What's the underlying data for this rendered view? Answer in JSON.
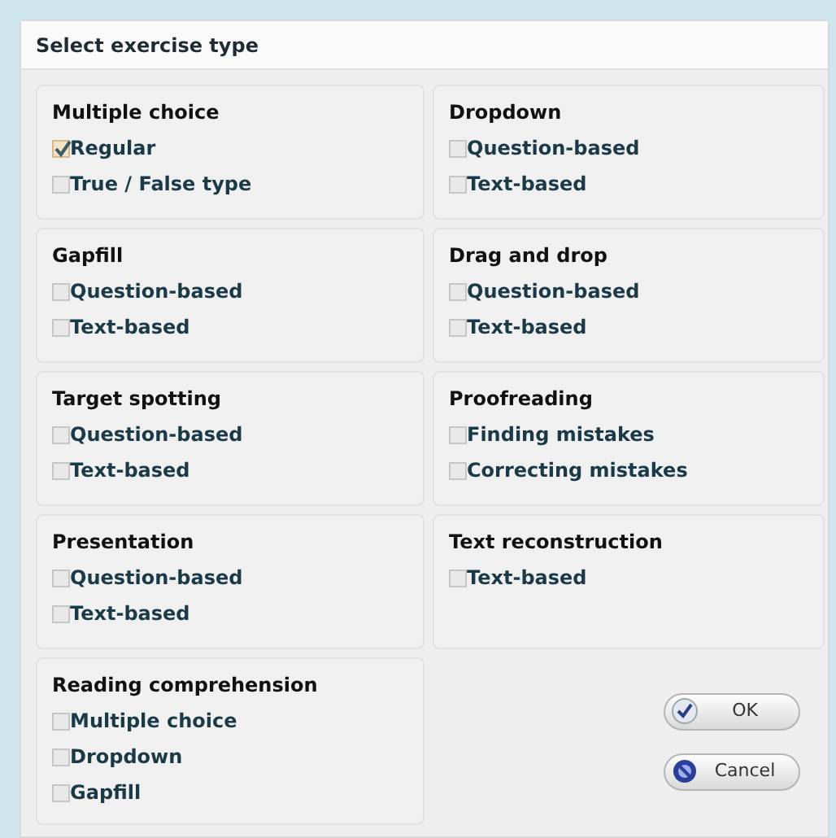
{
  "dialog": {
    "title": "Select exercise type"
  },
  "groups": [
    {
      "title": "Multiple choice",
      "options": [
        {
          "label": "Regular",
          "checked": true
        },
        {
          "label": "True / False type",
          "checked": false
        }
      ]
    },
    {
      "title": "Dropdown",
      "options": [
        {
          "label": "Question-based",
          "checked": false
        },
        {
          "label": "Text-based",
          "checked": false
        }
      ]
    },
    {
      "title": "Gapfill",
      "options": [
        {
          "label": "Question-based",
          "checked": false
        },
        {
          "label": "Text-based",
          "checked": false
        }
      ]
    },
    {
      "title": "Drag and drop",
      "options": [
        {
          "label": "Question-based",
          "checked": false
        },
        {
          "label": "Text-based",
          "checked": false
        }
      ]
    },
    {
      "title": "Target spotting",
      "options": [
        {
          "label": "Question-based",
          "checked": false
        },
        {
          "label": "Text-based",
          "checked": false
        }
      ]
    },
    {
      "title": "Proofreading",
      "options": [
        {
          "label": "Finding mistakes",
          "checked": false
        },
        {
          "label": "Correcting mistakes",
          "checked": false
        }
      ]
    },
    {
      "title": "Presentation",
      "options": [
        {
          "label": "Question-based",
          "checked": false
        },
        {
          "label": "Text-based",
          "checked": false
        }
      ]
    },
    {
      "title": "Text reconstruction",
      "options": [
        {
          "label": "Text-based",
          "checked": false
        }
      ]
    },
    {
      "title": "Reading comprehension",
      "options": [
        {
          "label": "Multiple choice",
          "checked": false
        },
        {
          "label": "Dropdown",
          "checked": false
        },
        {
          "label": "Gapfill",
          "checked": false
        }
      ]
    }
  ],
  "buttons": [
    {
      "label": "OK",
      "kind": "ok"
    },
    {
      "label": "Cancel",
      "kind": "cancel"
    }
  ]
}
